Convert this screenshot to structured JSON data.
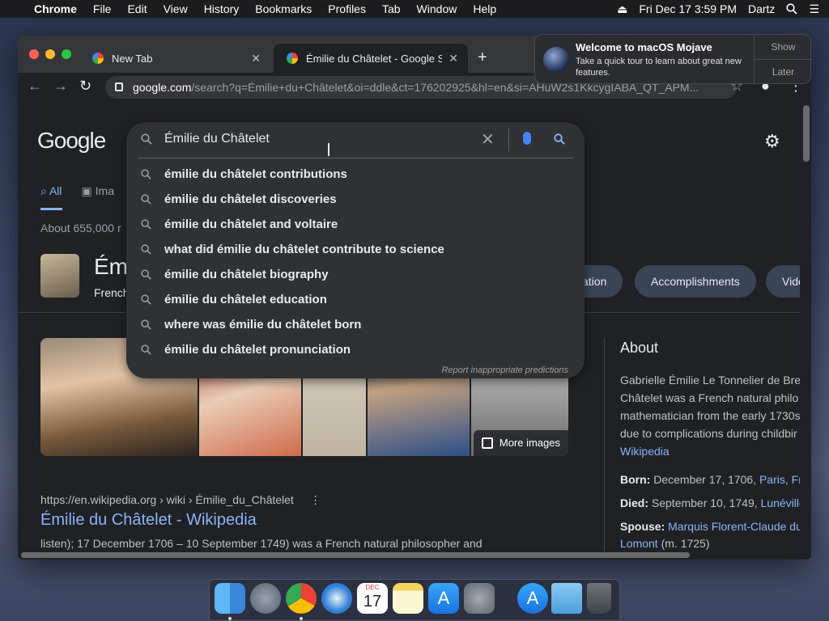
{
  "menubar": {
    "app": "Chrome",
    "items": [
      "File",
      "Edit",
      "View",
      "History",
      "Bookmarks",
      "Profiles",
      "Tab",
      "Window",
      "Help"
    ],
    "clock": "Fri Dec 17  3:59 PM",
    "user": "Dartz"
  },
  "tabs": [
    {
      "title": "New Tab"
    },
    {
      "title": "Émilie du Châtelet - Google Se"
    }
  ],
  "address": {
    "host": "google.com",
    "rest": "/search?q=Émilie+du+Châtelet&oi=ddle&ct=176202925&hl=en&si=AHuW2s1KkcygIABA_QT_APM..."
  },
  "google": {
    "logo": "Google",
    "tabs": {
      "all": "All",
      "images": "Ima"
    },
    "result_count": "About 655,000 r"
  },
  "knowledge": {
    "title": "Émi",
    "subtitle": "French",
    "chips": [
      "cation",
      "Accomplishments",
      "Vide"
    ]
  },
  "images": {
    "more": "More images"
  },
  "result": {
    "cite": "https://en.wikipedia.org › wiki › Émilie_du_Châtelet",
    "cite_menu": "⋮",
    "title": "Émilie du Châtelet - Wikipedia",
    "snippet": "listen); 17 December 1706 – 10 September 1749) was a French natural philosopher and"
  },
  "about": {
    "heading": "About",
    "lines": [
      "Gabrielle Émilie Le Tonnelier de Bre",
      "Châtelet was a French natural philo",
      "mathematician from the early 1730s",
      "due to complications during childbir"
    ],
    "source": "Wikipedia",
    "born_label": "Born:",
    "born_value": "December 17, 1706,",
    "born_link1": "Paris",
    "born_link2": "Fr",
    "died_label": "Died:",
    "died_value": "September 10, 1749,",
    "died_link": "Lunéville",
    "spouse_label": "Spouse:",
    "spouse_link": "Marquis Florent-Claude du",
    "spouse_link2": "Lomont",
    "spouse_year": "(m. 1725)"
  },
  "search": {
    "query": "Émilie du Châtelet",
    "suggestions": [
      "émilie du châtelet contributions",
      "émilie du châtelet discoveries",
      "émilie du châtelet and voltaire",
      "what did émilie du châtelet contribute to science",
      "émilie du châtelet biography",
      "émilie du châtelet education",
      "where was émilie du châtelet born",
      "émilie du châtelet pronunciation"
    ],
    "report": "Report inappropriate predictions"
  },
  "notification": {
    "title": "Welcome to macOS Mojave",
    "body": "Take a quick tour to learn about great new features.",
    "show": "Show",
    "later": "Later"
  },
  "dock": {
    "apps": [
      "finder-icon",
      "launchpad-icon",
      "chrome-icon",
      "safari-icon",
      "calendar-icon",
      "notes-icon",
      "app-store-icon",
      "system-preferences-icon",
      "app-store-downloads-icon",
      "downloads-folder-icon",
      "trash-icon"
    ],
    "calendar_month": "DEC",
    "calendar_day": "17"
  },
  "colors": {
    "accent": "#8ab4f8",
    "background": "#202124"
  }
}
